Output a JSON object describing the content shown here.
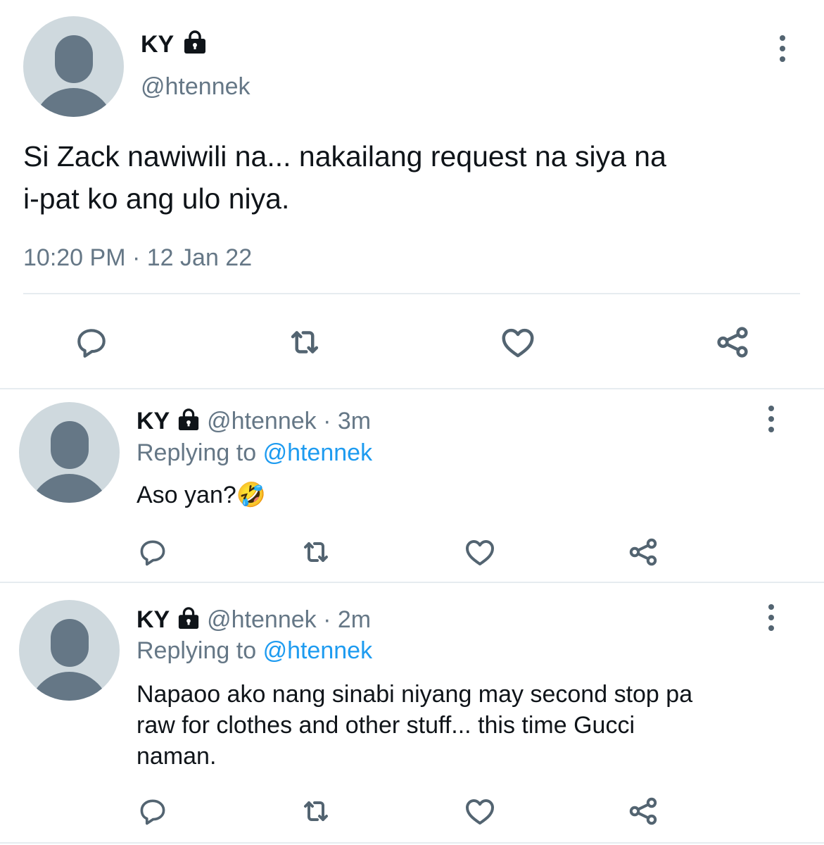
{
  "main_tweet": {
    "display_name": "KY",
    "handle": "@htennek",
    "text_line1": "Si Zack nawiwili na... nakailang request na siya na",
    "text_line2": "i-pat ko ang ulo niya.",
    "time": "10:20 PM",
    "separator": "·",
    "date": "12 Jan 22"
  },
  "replies": [
    {
      "display_name": "KY",
      "handle": "@htennek",
      "separator": "·",
      "age": "3m",
      "replying_label": "Replying to",
      "replying_handle": "@htennek",
      "text": "Aso yan?",
      "emoji": "🤣"
    },
    {
      "display_name": "KY",
      "handle": "@htennek",
      "separator": "·",
      "age": "2m",
      "replying_label": "Replying to",
      "replying_handle": "@htennek",
      "text_line1": "Napaoo ako nang sinabi niyang may second stop pa",
      "text_line2": "raw for clothes and other stuff... this time Gucci",
      "text_line3": "naman."
    }
  ],
  "icons": [
    "default-avatar",
    "lock-icon",
    "more-icon",
    "reply-icon",
    "retweet-icon",
    "like-icon",
    "share-icon"
  ],
  "colors": {
    "accent": "#1d9bf0",
    "muted": "#657786",
    "icon": "#536471",
    "avatar_bg": "#cfd9de",
    "avatar_fg": "#657786",
    "divider": "#e6ecf0"
  }
}
